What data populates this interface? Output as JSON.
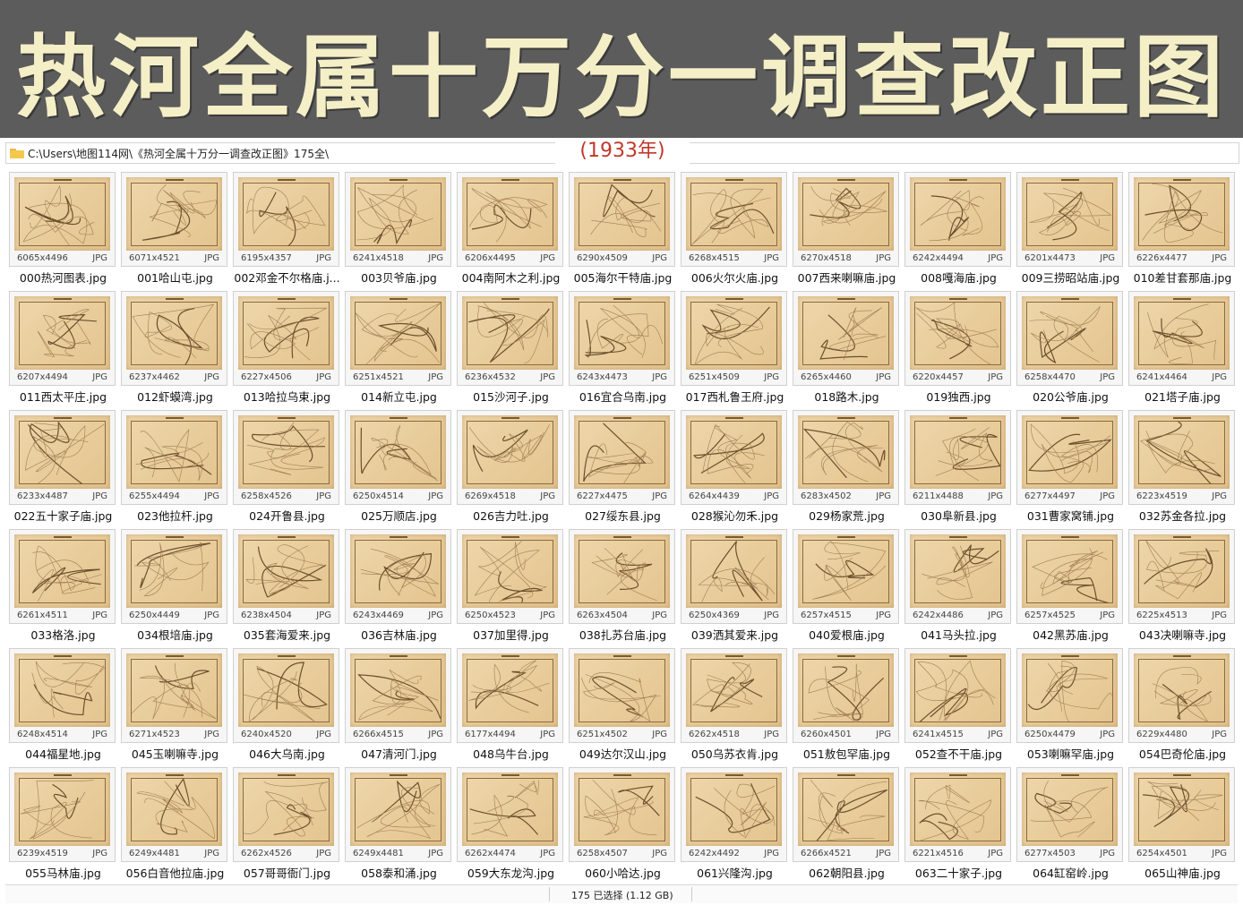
{
  "banner": {
    "title": "热河全属十万分一调查改正图"
  },
  "year_label": "(1933年)",
  "address_bar": {
    "path": "C:\\Users\\地图114网\\《热河全属十万分一调查改正图》175全\\",
    "icon": "folder-icon"
  },
  "colors": {
    "banner_bg": "#5c5c5c",
    "banner_text": "#f4efc6",
    "year_text": "#c0392b",
    "map_paper": "#e8cc9a"
  },
  "files": [
    {
      "name": "000热河图表.jpg",
      "dims": "6065x4496",
      "type": "JPG"
    },
    {
      "name": "001哈山屯.jpg",
      "dims": "6071x4521",
      "type": "JPG"
    },
    {
      "name": "002邓金不尔格庙.j...",
      "dims": "6195x4357",
      "type": "JPG"
    },
    {
      "name": "003贝爷庙.jpg",
      "dims": "6241x4518",
      "type": "JPG"
    },
    {
      "name": "004南阿木之利.jpg",
      "dims": "6206x4495",
      "type": "JPG"
    },
    {
      "name": "005海尔干特庙.jpg",
      "dims": "6290x4509",
      "type": "JPG"
    },
    {
      "name": "006火尔火庙.jpg",
      "dims": "6268x4515",
      "type": "JPG"
    },
    {
      "name": "007西来喇嘛庙.jpg",
      "dims": "6270x4518",
      "type": "JPG"
    },
    {
      "name": "008嘎海庙.jpg",
      "dims": "6242x4494",
      "type": "JPG"
    },
    {
      "name": "009三捞昭站庙.jpg",
      "dims": "6201x4473",
      "type": "JPG"
    },
    {
      "name": "010差甘套那庙.jpg",
      "dims": "6226x4477",
      "type": "JPG"
    },
    {
      "name": "011西太平庄.jpg",
      "dims": "6207x4494",
      "type": "JPG"
    },
    {
      "name": "012虾蟆湾.jpg",
      "dims": "6237x4462",
      "type": "JPG"
    },
    {
      "name": "013哈拉乌束.jpg",
      "dims": "6227x4506",
      "type": "JPG"
    },
    {
      "name": "014新立屯.jpg",
      "dims": "6251x4521",
      "type": "JPG"
    },
    {
      "name": "015沙河子.jpg",
      "dims": "6236x4532",
      "type": "JPG"
    },
    {
      "name": "016宜合乌南.jpg",
      "dims": "6243x4473",
      "type": "JPG"
    },
    {
      "name": "017西札鲁王府.jpg",
      "dims": "6251x4509",
      "type": "JPG"
    },
    {
      "name": "018路木.jpg",
      "dims": "6265x4460",
      "type": "JPG"
    },
    {
      "name": "019独西.jpg",
      "dims": "6220x4457",
      "type": "JPG"
    },
    {
      "name": "020公爷庙.jpg",
      "dims": "6258x4470",
      "type": "JPG"
    },
    {
      "name": "021塔子庙.jpg",
      "dims": "6241x4464",
      "type": "JPG"
    },
    {
      "name": "022五十家子庙.jpg",
      "dims": "6233x4487",
      "type": "JPG"
    },
    {
      "name": "023他拉杆.jpg",
      "dims": "6255x4494",
      "type": "JPG"
    },
    {
      "name": "024开鲁县.jpg",
      "dims": "6258x4526",
      "type": "JPG"
    },
    {
      "name": "025万顺店.jpg",
      "dims": "6250x4514",
      "type": "JPG"
    },
    {
      "name": "026吉力吐.jpg",
      "dims": "6269x4518",
      "type": "JPG"
    },
    {
      "name": "027绥东县.jpg",
      "dims": "6227x4475",
      "type": "JPG"
    },
    {
      "name": "028猴沁勿禾.jpg",
      "dims": "6264x4439",
      "type": "JPG"
    },
    {
      "name": "029杨家荒.jpg",
      "dims": "6283x4502",
      "type": "JPG"
    },
    {
      "name": "030阜新县.jpg",
      "dims": "6211x4488",
      "type": "JPG"
    },
    {
      "name": "031曹家窝铺.jpg",
      "dims": "6277x4497",
      "type": "JPG"
    },
    {
      "name": "032苏金各拉.jpg",
      "dims": "6223x4519",
      "type": "JPG"
    },
    {
      "name": "033格洛.jpg",
      "dims": "6261x4511",
      "type": "JPG"
    },
    {
      "name": "034根培庙.jpg",
      "dims": "6250x4449",
      "type": "JPG"
    },
    {
      "name": "035套海爱来.jpg",
      "dims": "6238x4504",
      "type": "JPG"
    },
    {
      "name": "036吉林庙.jpg",
      "dims": "6243x4469",
      "type": "JPG"
    },
    {
      "name": "037加里得.jpg",
      "dims": "6250x4523",
      "type": "JPG"
    },
    {
      "name": "038扎苏台庙.jpg",
      "dims": "6263x4504",
      "type": "JPG"
    },
    {
      "name": "039洒其爱来.jpg",
      "dims": "6250x4369",
      "type": "JPG"
    },
    {
      "name": "040爱根庙.jpg",
      "dims": "6257x4515",
      "type": "JPG"
    },
    {
      "name": "041马头拉.jpg",
      "dims": "6242x4486",
      "type": "JPG"
    },
    {
      "name": "042黑苏庙.jpg",
      "dims": "6257x4525",
      "type": "JPG"
    },
    {
      "name": "043决喇嘛寺.jpg",
      "dims": "6225x4513",
      "type": "JPG"
    },
    {
      "name": "044福星地.jpg",
      "dims": "6248x4514",
      "type": "JPG"
    },
    {
      "name": "045玉喇嘛寺.jpg",
      "dims": "6271x4523",
      "type": "JPG"
    },
    {
      "name": "046大乌南.jpg",
      "dims": "6240x4520",
      "type": "JPG"
    },
    {
      "name": "047清河门.jpg",
      "dims": "6266x4515",
      "type": "JPG"
    },
    {
      "name": "048乌牛台.jpg",
      "dims": "6177x4494",
      "type": "JPG"
    },
    {
      "name": "049达尔汉山.jpg",
      "dims": "6251x4502",
      "type": "JPG"
    },
    {
      "name": "050乌苏衣肯.jpg",
      "dims": "6262x4518",
      "type": "JPG"
    },
    {
      "name": "051敖包罕庙.jpg",
      "dims": "6260x4501",
      "type": "JPG"
    },
    {
      "name": "052查不干庙.jpg",
      "dims": "6241x4515",
      "type": "JPG"
    },
    {
      "name": "053喇嘛罕庙.jpg",
      "dims": "6250x4479",
      "type": "JPG"
    },
    {
      "name": "054巴奇伦庙.jpg",
      "dims": "6229x4480",
      "type": "JPG"
    },
    {
      "name": "055马林庙.jpg",
      "dims": "6239x4519",
      "type": "JPG"
    },
    {
      "name": "056白音他拉庙.jpg",
      "dims": "6249x4481",
      "type": "JPG"
    },
    {
      "name": "057哥哥衙门.jpg",
      "dims": "6262x4526",
      "type": "JPG"
    },
    {
      "name": "058泰和涌.jpg",
      "dims": "6249x4481",
      "type": "JPG"
    },
    {
      "name": "059大东龙沟.jpg",
      "dims": "6262x4474",
      "type": "JPG"
    },
    {
      "name": "060小哈达.jpg",
      "dims": "6258x4507",
      "type": "JPG"
    },
    {
      "name": "061兴隆沟.jpg",
      "dims": "6242x4492",
      "type": "JPG"
    },
    {
      "name": "062朝阳县.jpg",
      "dims": "6266x4521",
      "type": "JPG"
    },
    {
      "name": "063二十家子.jpg",
      "dims": "6221x4516",
      "type": "JPG"
    },
    {
      "name": "064缸窑岭.jpg",
      "dims": "6277x4503",
      "type": "JPG"
    },
    {
      "name": "065山神庙.jpg",
      "dims": "6254x4501",
      "type": "JPG"
    }
  ],
  "status_bar": {
    "selection": "175 已选择 (1.12 GB)"
  }
}
